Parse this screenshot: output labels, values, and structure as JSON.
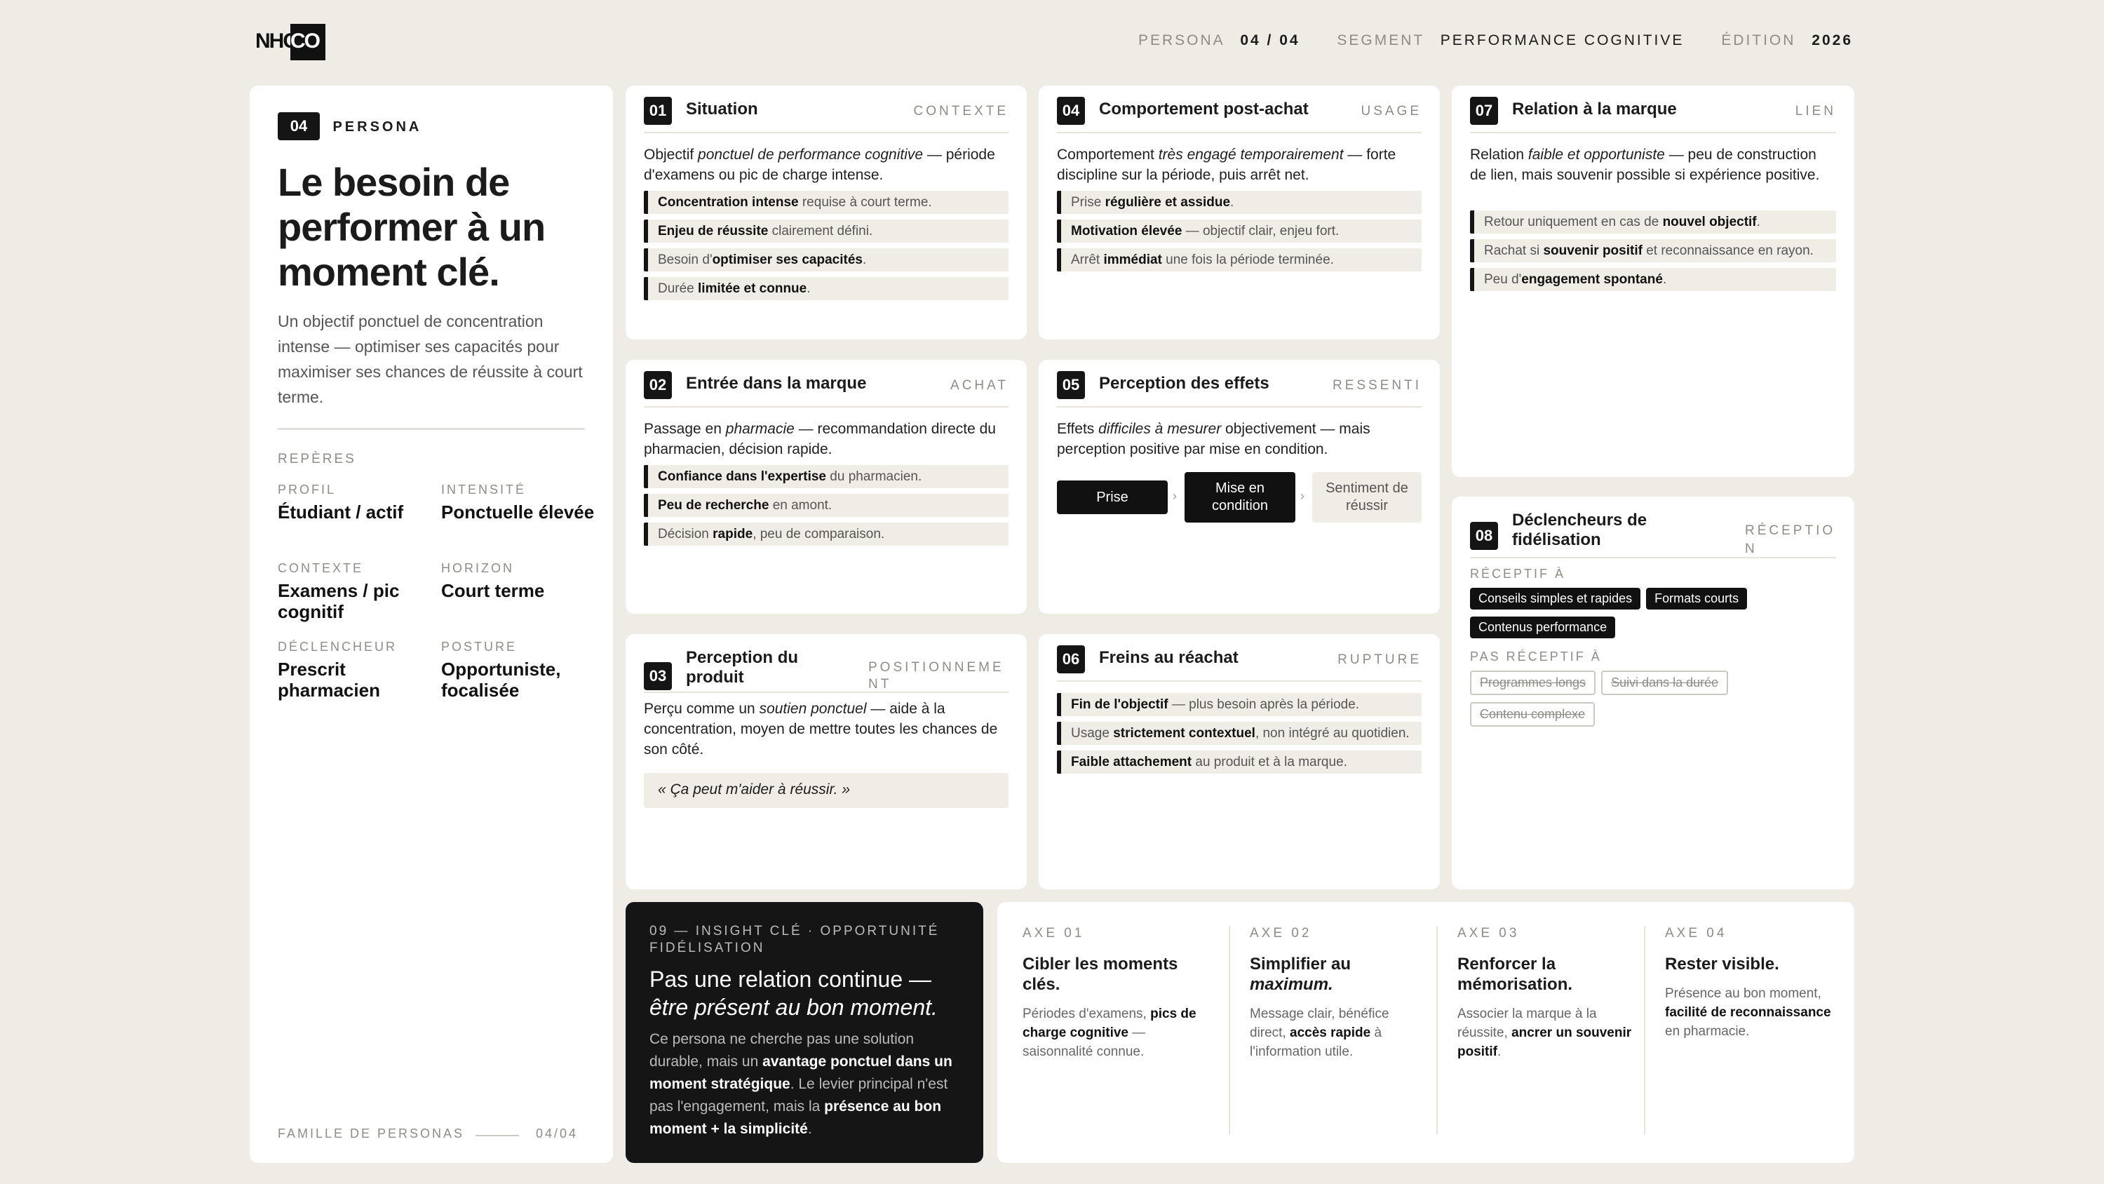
{
  "header": {
    "logo": "NHCO",
    "persona_label": "PERSONA",
    "persona_value": "04 / 04",
    "segment_label": "SEGMENT",
    "segment_value": "PERFORMANCE COGNITIVE",
    "edition_label": "ÉDITION",
    "edition_value": "2026"
  },
  "profile": {
    "number": "04",
    "tag": "PERSONA",
    "title": "Le besoin de performer à un moment clé.",
    "description": "Un objectif ponctuel de concentration intense — optimiser ses capacités pour maximiser ses chances de réussite à court terme.",
    "reperes_label": "REPÈRES",
    "fields": [
      {
        "label": "PROFIL",
        "value": "Étudiant / actif"
      },
      {
        "label": "INTENSITÉ",
        "value": "Ponctuelle élevée"
      },
      {
        "label": "CONTEXTE",
        "value": "Examens / pic cognitif"
      },
      {
        "label": "HORIZON",
        "value": "Court terme"
      },
      {
        "label": "DÉCLENCHEUR",
        "value": "Prescrit pharmacien"
      },
      {
        "label": "POSTURE",
        "value": "Opportuniste, focalisée"
      }
    ],
    "footer_label": "FAMILLE DE PERSONAS",
    "footer_value": "04/04"
  },
  "cards": {
    "c01": {
      "num": "01",
      "title": "Situation",
      "tag": "CONTEXTE",
      "intro": [
        "Objectif ",
        "ponctuel de performance cognitive",
        " — période d'examens ou pic de charge intense."
      ],
      "items": [
        [
          "",
          "Concentration intense",
          " requise à court terme."
        ],
        [
          "",
          "Enjeu de réussite",
          " clairement défini."
        ],
        [
          "Besoin d'",
          "optimiser ses capacités",
          "."
        ],
        [
          "Durée ",
          "limitée et connue",
          "."
        ]
      ]
    },
    "c02": {
      "num": "02",
      "title": "Entrée dans la marque",
      "tag": "ACHAT",
      "intro": [
        "Passage en ",
        "pharmacie",
        " — recommandation directe du pharmacien, décision rapide."
      ],
      "items": [
        [
          "",
          "Confiance dans l'expertise",
          " du pharmacien."
        ],
        [
          "",
          "Peu de recherche",
          " en amont."
        ],
        [
          "Décision ",
          "rapide",
          ", peu de comparaison."
        ]
      ]
    },
    "c03": {
      "num": "03",
      "title": "Perception du produit",
      "tag": "POSITIONNEMENT",
      "intro": [
        "Perçu comme un ",
        "soutien ponctuel",
        " — aide à la concentration, moyen de mettre toutes les chances de son côté."
      ],
      "quote": "« Ça peut m'aider à réussir. »"
    },
    "c04": {
      "num": "04",
      "title": "Comportement post-achat",
      "tag": "USAGE",
      "intro": [
        "Comportement ",
        "très engagé temporairement",
        " — forte discipline sur la période, puis arrêt net."
      ],
      "items": [
        [
          "Prise ",
          "régulière et assidue",
          "."
        ],
        [
          "",
          "Motivation élevée",
          " — objectif clair, enjeu fort."
        ],
        [
          "Arrêt ",
          "immédiat",
          " une fois la période terminée."
        ]
      ]
    },
    "c05": {
      "num": "05",
      "title": "Perception des effets",
      "tag": "RESSENTI",
      "intro": [
        "Effets ",
        "difficiles à mesurer",
        " objectivement — mais perception positive par mise en condition."
      ],
      "steps": [
        "Prise",
        "Mise en condition",
        "Sentiment de réussir"
      ]
    },
    "c06": {
      "num": "06",
      "title": "Freins au réachat",
      "tag": "RUPTURE",
      "items": [
        [
          "",
          "Fin de l'objectif",
          " — plus besoin après la période."
        ],
        [
          "Usage ",
          "strictement contextuel",
          ", non intégré au quotidien."
        ],
        [
          "",
          "Faible attachement",
          " au produit et à la marque."
        ]
      ]
    },
    "c07": {
      "num": "07",
      "title": "Relation à la marque",
      "tag": "LIEN",
      "intro": [
        "Relation ",
        "faible et opportuniste",
        " — peu de construction de lien, mais souvenir possible si expérience positive."
      ],
      "items": [
        [
          "Retour uniquement en cas de ",
          "nouvel objectif",
          "."
        ],
        [
          "Rachat si ",
          "souvenir positif",
          " et reconnaissance en rayon."
        ],
        [
          "Peu d'",
          "engagement spontané",
          "."
        ]
      ]
    },
    "c08": {
      "num": "08",
      "title": "Déclencheurs de fidélisation",
      "tag": "RÉCEPTION",
      "receptive_label": "RÉCEPTIF À",
      "receptive": [
        "Conseils simples et rapides",
        "Formats courts",
        "Contenus performance"
      ],
      "not_receptive_label": "PAS RÉCEPTIF À",
      "not_receptive": [
        "Programmes longs",
        "Suivi dans la durée",
        "Contenu complexe"
      ]
    }
  },
  "insight": {
    "kicker": "09 — INSIGHT CLÉ · OPPORTUNITÉ FIDÉLISATION",
    "title_1": "Pas une relation continue —",
    "title_2": "être présent au bon moment.",
    "body": [
      "Ce persona ne cherche pas une solution durable, mais un ",
      "avantage ponctuel dans un moment stratégique",
      ". Le levier principal n'est pas l'engagement, mais la ",
      "présence au bon moment + la simplicité",
      "."
    ]
  },
  "axes": [
    {
      "label": "AXE 01",
      "title": "Cibler les moments clés.",
      "desc": [
        "Périodes d'examens, ",
        "pics de charge cognitive",
        " — saisonnalité connue."
      ]
    },
    {
      "label": "AXE 02",
      "title_a": "Simplifier au ",
      "title_b": "maximum.",
      "desc": [
        "Message clair, bénéfice direct, ",
        "accès rapide",
        " à l'information utile."
      ]
    },
    {
      "label": "AXE 03",
      "title": "Renforcer la mémorisation.",
      "desc": [
        "Associer la marque à la réussite, ",
        "ancrer un souvenir positif",
        "."
      ]
    },
    {
      "label": "AXE 04",
      "title": "Rester visible.",
      "desc": [
        "Présence au bon moment, ",
        "facilité de reconnaissance",
        " en pharmacie."
      ]
    }
  ]
}
